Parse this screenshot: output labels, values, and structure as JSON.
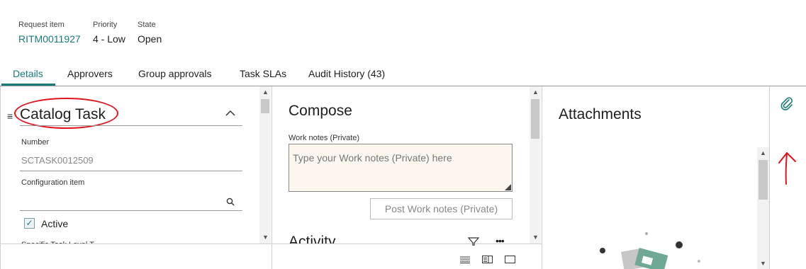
{
  "header": {
    "request_item_label": "Request item",
    "request_item_value": "RITM0011927",
    "priority_label": "Priority",
    "priority_value": "4 - Low",
    "state_label": "State",
    "state_value": "Open"
  },
  "tabs": [
    {
      "label": "Details",
      "active": true
    },
    {
      "label": "Approvers"
    },
    {
      "label": "Group approvals"
    },
    {
      "label": "Task SLAs"
    },
    {
      "label": "Audit History (43)"
    }
  ],
  "catalog_task": {
    "title": "Catalog Task",
    "number_label": "Number",
    "number_value": "SCTASK0012509",
    "config_item_label": "Configuration item",
    "config_item_value": "",
    "active_label": "Active",
    "active_checked": true,
    "next_field_label": "Specific Task Level T..."
  },
  "compose": {
    "title": "Compose",
    "work_notes_label": "Work notes (Private)",
    "work_notes_placeholder": "Type your Work notes (Private) here",
    "post_button": "Post Work notes (Private)",
    "activity_title": "Activity"
  },
  "attachments": {
    "title": "Attachments"
  },
  "colors": {
    "accent": "#1a7a7a",
    "annotation_red": "#e0141e",
    "worknotes_bg": "#fdf6ee"
  },
  "icons": {
    "paperclip": "paperclip-icon",
    "search": "search-icon",
    "collapse": "chevron-up-icon",
    "filter": "filter-icon",
    "more": "more-icon",
    "drag_handle": "drag-handle-icon"
  }
}
